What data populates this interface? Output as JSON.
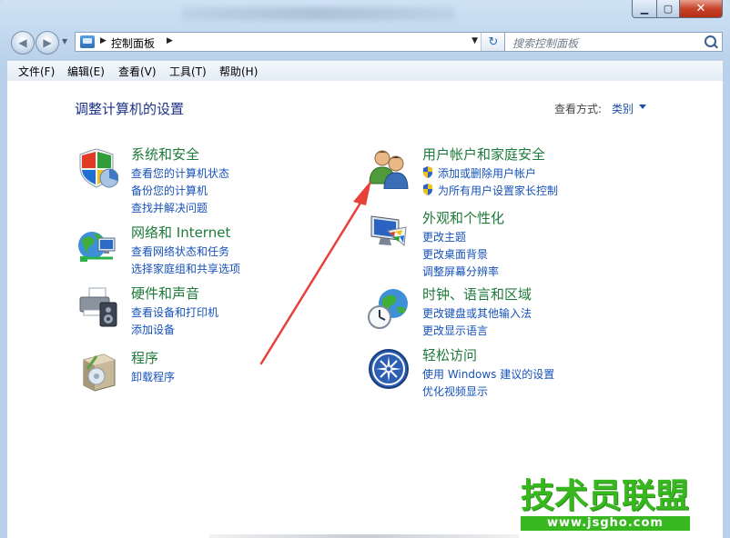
{
  "address_bar": {
    "breadcrumb": "控制面板"
  },
  "search": {
    "placeholder": "搜索控制面板"
  },
  "menu": [
    {
      "label": "文件(F)"
    },
    {
      "label": "编辑(E)"
    },
    {
      "label": "查看(V)"
    },
    {
      "label": "工具(T)"
    },
    {
      "label": "帮助(H)"
    }
  ],
  "main": {
    "heading": "调整计算机的设置",
    "view_by_label": "查看方式:",
    "view_by_value": "类别"
  },
  "categories": [
    {
      "title": "系统和安全",
      "icon": "shield-icon",
      "links": [
        "查看您的计算机状态",
        "备份您的计算机",
        "查找并解决问题"
      ]
    },
    {
      "title": "网络和 Internet",
      "icon": "network-globe-icon",
      "links": [
        "查看网络状态和任务",
        "选择家庭组和共享选项"
      ]
    },
    {
      "title": "硬件和声音",
      "icon": "printer-speaker-icon",
      "links": [
        "查看设备和打印机",
        "添加设备"
      ]
    },
    {
      "title": "程序",
      "icon": "programs-box-icon",
      "links": [
        "卸载程序"
      ]
    },
    {
      "title": "用户帐户和家庭安全",
      "icon": "users-icon",
      "links": [
        "添加或删除用户帐户",
        "为所有用户设置家长控制"
      ]
    },
    {
      "title": "外观和个性化",
      "icon": "monitor-palette-icon",
      "links": [
        "更改主题",
        "更改桌面背景",
        "调整屏幕分辨率"
      ]
    },
    {
      "title": "时钟、语言和区域",
      "icon": "clock-globe-icon",
      "links": [
        "更改键盘或其他输入法",
        "更改显示语言"
      ]
    },
    {
      "title": "轻松访问",
      "icon": "ease-of-access-icon",
      "links": [
        "使用 Windows 建议的设置",
        "优化视频显示"
      ]
    }
  ],
  "watermark": {
    "title": "技术员联盟",
    "url": "www.jsgho.com"
  },
  "colors": {
    "category_title": "#1e7a3a",
    "link": "#1752b9",
    "annotation_arrow": "#e8413a",
    "watermark": "#38b81f"
  }
}
